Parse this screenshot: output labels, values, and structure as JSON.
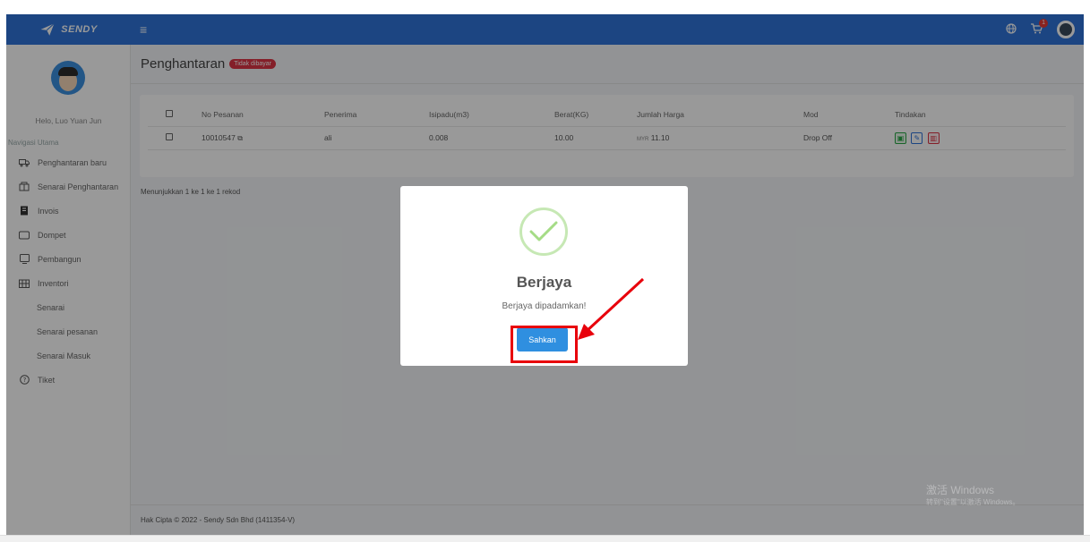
{
  "brand": {
    "name": "SENDY"
  },
  "topbar": {
    "menu_icon": "hamburger-icon",
    "cart_count": "1"
  },
  "sidebar": {
    "greeting": "Helo, Luo Yuan Jun",
    "nav_title": "Navigasi Utama",
    "items": [
      {
        "label": "Penghantaran baru",
        "icon": "truck-icon"
      },
      {
        "label": "Senarai Penghantaran",
        "icon": "building-icon"
      },
      {
        "label": "Invois",
        "icon": "invoice-icon"
      },
      {
        "label": "Dompet",
        "icon": "wallet-icon"
      },
      {
        "label": "Pembangun",
        "icon": "developer-icon"
      },
      {
        "label": "Inventori",
        "icon": "inventory-icon"
      },
      {
        "label": "Senarai"
      },
      {
        "label": "Senarai pesanan"
      },
      {
        "label": "Senarai Masuk"
      },
      {
        "label": "Tiket",
        "icon": "ticket-icon"
      }
    ]
  },
  "page": {
    "title": "Penghantaran",
    "badge": "Tidak dibayar"
  },
  "table": {
    "headers": [
      "No Pesanan",
      "Penerima",
      "Isipadu(m3)",
      "Berat(KG)",
      "Jumlah Harga",
      "Mod",
      "Tindakan"
    ],
    "rows": [
      {
        "order_no": "10010547",
        "recipient": "ali",
        "volume": "0.008",
        "weight": "10.00",
        "currency": "MYR",
        "price": "11.10",
        "mode": "Drop Off"
      }
    ]
  },
  "showing": "Menunjukkan 1 ke 1 ke 1 rekod",
  "footer": "Hak Cipta © 2022 - Sendy Sdn Bhd (1411354-V)",
  "modal": {
    "title": "Berjaya",
    "message": "Berjaya dipadamkan!",
    "confirm_label": "Sahkan"
  },
  "watermark": {
    "line1": "激活 Windows",
    "line2": "转到\"设置\"以激活 Windows。"
  },
  "colors": {
    "primary": "#2f74d9",
    "danger": "#dc3545",
    "success": "#28a745",
    "annotation": "#e8000b"
  }
}
